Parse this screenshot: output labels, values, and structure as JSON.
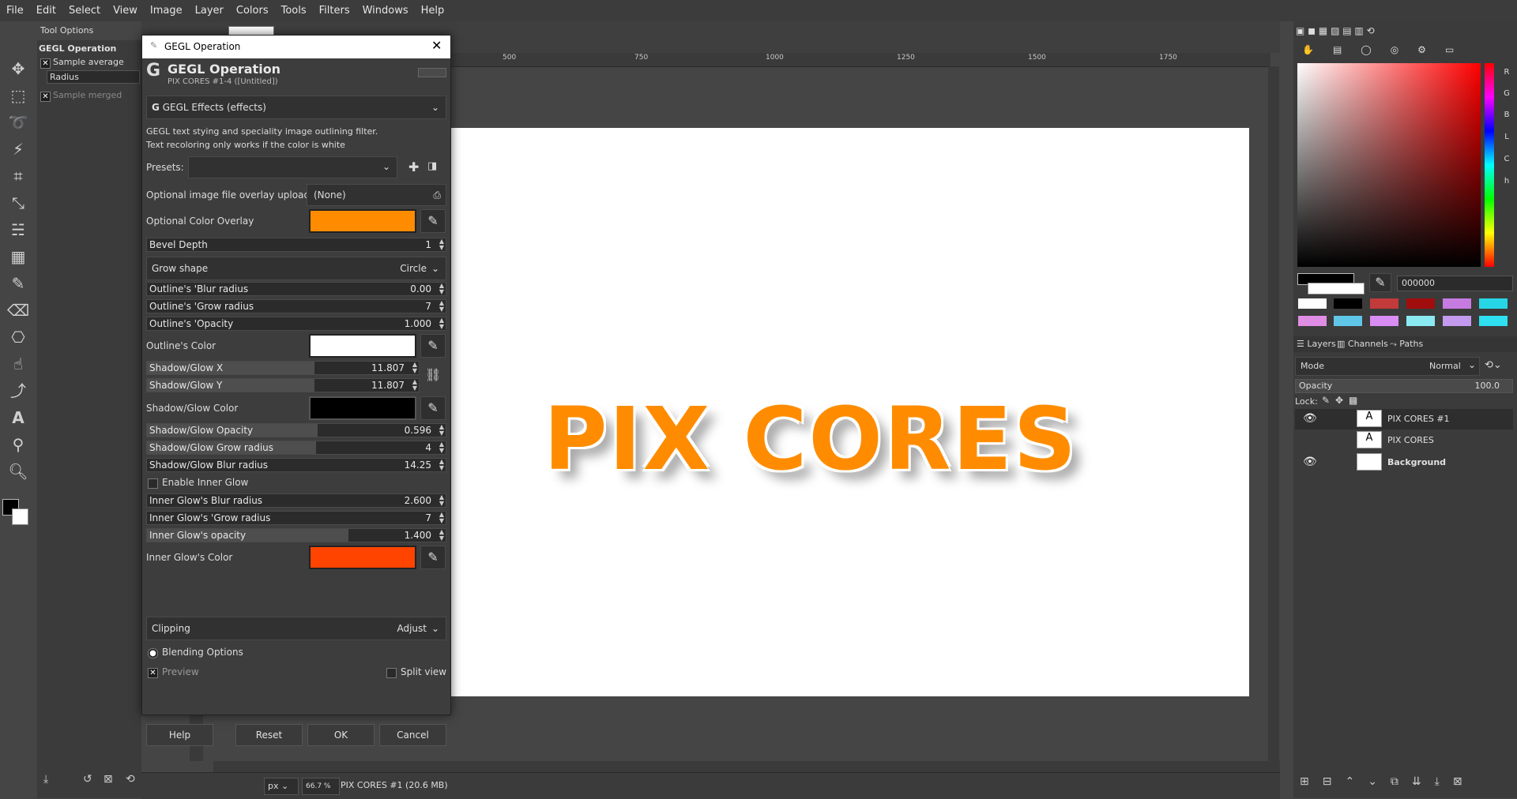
{
  "menubar": [
    "File",
    "Edit",
    "Select",
    "View",
    "Image",
    "Layer",
    "Colors",
    "Tools",
    "Filters",
    "Windows",
    "Help"
  ],
  "tool_options": {
    "tab_label": "Tool Options",
    "title": "GEGL Operation",
    "sample_average": "Sample average",
    "radius_label": "Radius",
    "sample_merged": "Sample merged"
  },
  "ruler": {
    "marks": [
      "500",
      "750",
      "1000",
      "1250",
      "1500",
      "1750"
    ]
  },
  "canvas": {
    "art_text": "PIX CORES"
  },
  "status": {
    "unit": "px",
    "zoom": "66.7 %",
    "info": "PIX CORES #1 (20.6 MB)"
  },
  "dialog": {
    "window_title": "GEGL Operation",
    "header_title": "GEGL Operation",
    "header_sub": "PIX CORES #1-4 ([Untitled])",
    "effect_name": "GEGL Effects (effects)",
    "description_1": "GEGL text stying and speciality image outlining filter.",
    "description_2": "Text recoloring only works if the color is white",
    "presets_label": "Presets:",
    "overlay_upload_label": "Optional image file overlay upload",
    "overlay_upload_value": "(None)",
    "color_overlay_label": "Optional Color Overlay",
    "bevel_depth_label": "Bevel Depth",
    "bevel_depth_value": "1",
    "grow_shape_label": "Grow shape",
    "grow_shape_value": "Circle",
    "outline_blur_label": "Outline's 'Blur radius",
    "outline_blur_value": "0.00",
    "outline_grow_label": "Outline's 'Grow radius",
    "outline_grow_value": "7",
    "outline_opacity_label": "Outline's 'Opacity",
    "outline_opacity_value": "1.000",
    "outline_color_label": "Outline's Color",
    "shadow_x_label": "Shadow/Glow X",
    "shadow_x_value": "11.807",
    "shadow_y_label": "Shadow/Glow Y",
    "shadow_y_value": "11.807",
    "shadow_color_label": "Shadow/Glow Color",
    "shadow_opacity_label": "Shadow/Glow Opacity",
    "shadow_opacity_value": "0.596",
    "shadow_grow_label": "Shadow/Glow Grow radius",
    "shadow_grow_value": "4",
    "shadow_blur_label": "Shadow/Glow Blur radius",
    "shadow_blur_value": "14.25",
    "inner_glow_enable_label": "Enable Inner Glow",
    "inner_blur_label": "Inner Glow's Blur radius",
    "inner_blur_value": "2.600",
    "inner_grow_label": "Inner Glow's 'Grow radius",
    "inner_grow_value": "7",
    "inner_opacity_label": "Inner Glow's opacity",
    "inner_opacity_value": "1.400",
    "inner_color_label": "Inner Glow's Color",
    "clipping_label": "Clipping",
    "clipping_value": "Adjust",
    "blending_label": "Blending Options",
    "preview_label": "Preview",
    "split_view_label": "Split view",
    "help_btn": "Help",
    "reset_btn": "Reset",
    "ok_btn": "OK",
    "cancel_btn": "Cancel",
    "colors": {
      "overlay": "#ff8c00",
      "outline": "#ffffff",
      "shadow": "#000000",
      "inner_glow": "#ff4400"
    }
  },
  "right_dock": {
    "color_modes": [
      "R",
      "G",
      "B",
      "L",
      "C",
      "h"
    ],
    "hex_value": "000000",
    "palette": [
      "#ffffff",
      "#000000",
      "#c23a3a",
      "#a10d0d",
      "#c67be0",
      "#27d6e6",
      "#e08de6",
      "#5fc6e8",
      "#d98df2",
      "#8be9f2",
      "#c39aee",
      "#2ee0f0"
    ],
    "tabs": {
      "layers": "Layers",
      "channels": "Channels",
      "paths": "Paths"
    },
    "mode_label": "Mode",
    "mode_value": "Normal",
    "opacity_label": "Opacity",
    "opacity_value": "100.0",
    "lock_label": "Lock:",
    "layers": [
      {
        "name": "PIX CORES #1",
        "visible": true
      },
      {
        "name": "PIX CORES",
        "visible": false
      },
      {
        "name": "Background",
        "visible": true
      }
    ]
  }
}
